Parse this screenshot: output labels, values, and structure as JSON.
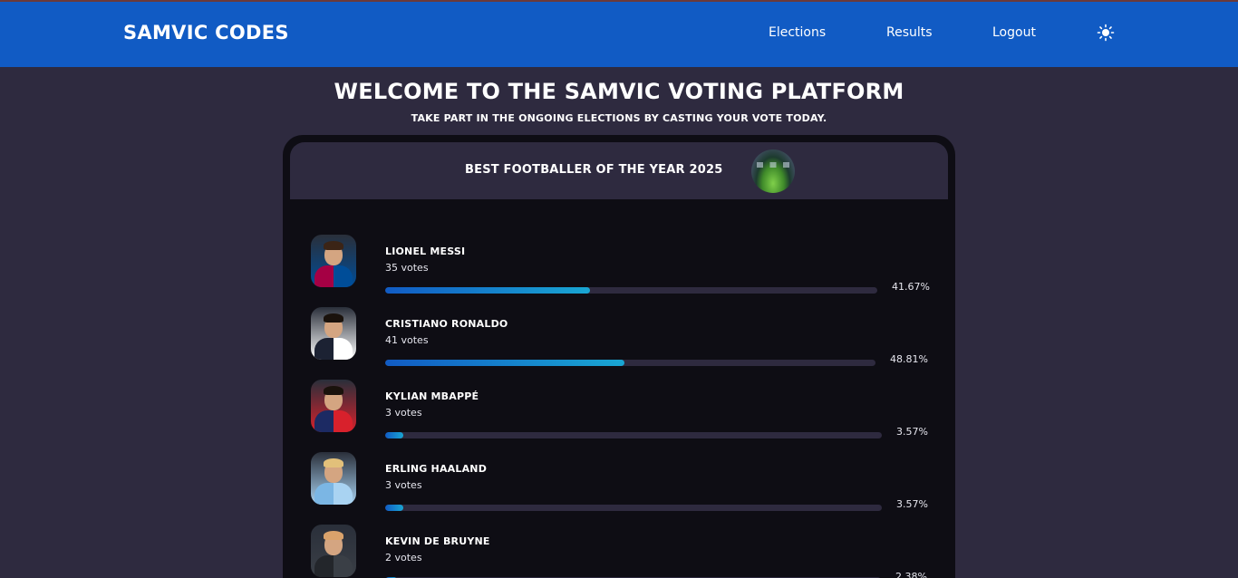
{
  "navbar": {
    "brand": "SAMVIC CODES",
    "links": [
      "Elections",
      "Results",
      "Logout"
    ],
    "theme_icon": "sun-icon",
    "color": "#115bc4"
  },
  "hero": {
    "title": "WELCOME TO THE SAMVIC VOTING PLATFORM",
    "subtitle": "TAKE PART IN THE ONGOING ELECTIONS BY CASTING YOUR VOTE TODAY."
  },
  "election": {
    "title": "BEST FOOTBALLER OF THE YEAR 2025",
    "candidates": [
      {
        "name": "LIONEL MESSI",
        "votes": "35 votes",
        "percent": "41.67%",
        "share": 0.4167,
        "kit": "#a50044",
        "kit2": "#004d98",
        "hair": "#3b2416"
      },
      {
        "name": "CRISTIANO RONALDO",
        "votes": "41 votes",
        "percent": "48.81%",
        "share": 0.4881,
        "kit": "#1c2233",
        "kit2": "#ffffff",
        "hair": "#1a120c"
      },
      {
        "name": "KYLIAN MBAPPÉ",
        "votes": "3 votes",
        "percent": "3.57%",
        "share": 0.0357,
        "kit": "#1c2a63",
        "kit2": "#d8212c",
        "hair": "#1a120c"
      },
      {
        "name": "ERLING HAALAND",
        "votes": "3 votes",
        "percent": "3.57%",
        "share": 0.0357,
        "kit": "#7bb6e4",
        "kit2": "#a9d3f2",
        "hair": "#e2c07a"
      },
      {
        "name": "KEVIN DE BRUYNE",
        "votes": "2 votes",
        "percent": "2.38%",
        "share": 0.0238,
        "kit": "#23262b",
        "kit2": "#3a3f46",
        "hair": "#d9a26b"
      }
    ]
  }
}
